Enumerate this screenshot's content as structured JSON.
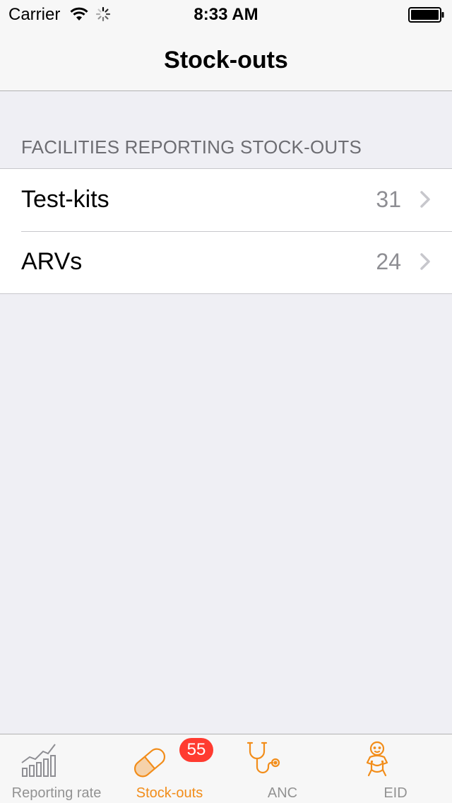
{
  "status_bar": {
    "carrier": "Carrier",
    "time": "8:33 AM",
    "icons": [
      "wifi-icon",
      "activity-spinner-icon",
      "battery-icon"
    ]
  },
  "nav": {
    "title": "Stock-outs"
  },
  "section": {
    "header": "FACILITIES REPORTING STOCK-OUTS",
    "rows": [
      {
        "label": "Test-kits",
        "value": "31"
      },
      {
        "label": "ARVs",
        "value": "24"
      }
    ]
  },
  "tab_bar": {
    "items": [
      {
        "label": "Reporting rate",
        "icon": "bar-chart-trend-icon",
        "active": false
      },
      {
        "label": "Stock-outs",
        "icon": "pill-capsule-icon",
        "active": true,
        "badge": "55"
      },
      {
        "label": "ANC",
        "icon": "stethoscope-icon",
        "active": false
      },
      {
        "label": "EID",
        "icon": "baby-icon",
        "active": false
      }
    ]
  },
  "colors": {
    "accent": "#f28d1a",
    "badge": "#ff3b30",
    "background": "#efeff4",
    "secondary_text": "#8e8e93"
  }
}
